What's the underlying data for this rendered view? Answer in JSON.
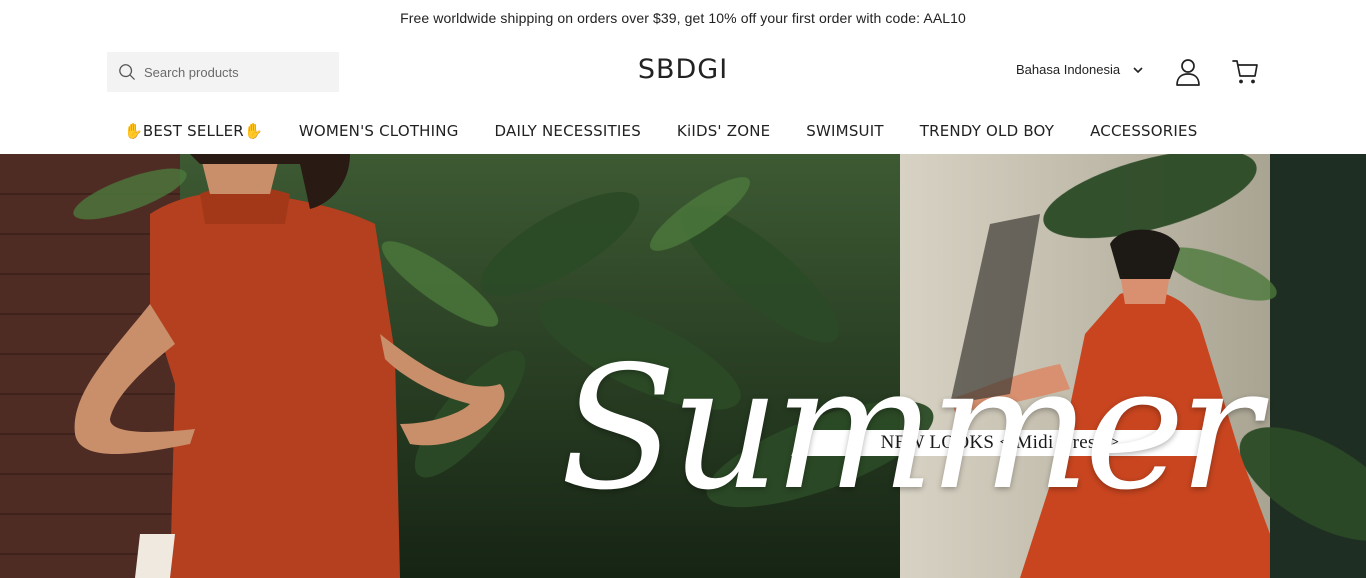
{
  "announcement": "Free worldwide shipping on orders over $39, get 10% off your first order with code: AAL10",
  "header": {
    "search_placeholder": "Search products",
    "logo": "SBDGI",
    "language": "Bahasa Indonesia",
    "icons": {
      "search": "search-icon",
      "language_toggle": "chevron-down-icon",
      "account": "user-icon",
      "cart": "cart-icon"
    }
  },
  "nav": {
    "items": [
      {
        "label": "BEST SELLER",
        "decoration": "✋"
      },
      {
        "label": "WOMEN'S CLOTHING"
      },
      {
        "label": "DAILY NECESSITIES"
      },
      {
        "label": "KiIDS' ZONE"
      },
      {
        "label": "SWIMSUIT"
      },
      {
        "label": "TRENDY OLD BOY"
      },
      {
        "label": "ACCESSORIES"
      }
    ]
  },
  "hero": {
    "subtitle": "NEW LOOKS < Midi Dress >",
    "title": "Summer"
  },
  "colors": {
    "dress": "#b5401f",
    "foliage": "#2f4a2a",
    "brick": "#5a2f26",
    "accent_hand": "#f2b632"
  }
}
